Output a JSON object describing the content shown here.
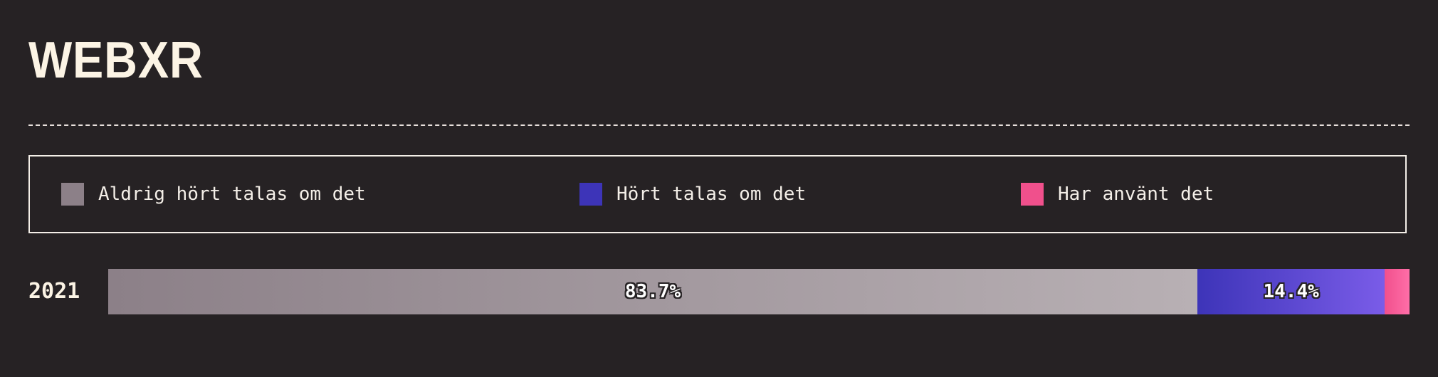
{
  "page": {
    "title": "WEBXR"
  },
  "legend": {
    "items": [
      {
        "label": "Aldrig hört talas om det",
        "color": "#8c8088"
      },
      {
        "label": "Hört talas om det",
        "color": "#3d34b8"
      },
      {
        "label": "Har använt det",
        "color": "#f0508c"
      }
    ]
  },
  "chart_data": {
    "type": "bar",
    "orientation": "horizontal",
    "stacked": true,
    "normalized": true,
    "title": "WEBXR",
    "categories": [
      "2021"
    ],
    "series": [
      {
        "name": "Aldrig hört talas om det",
        "values": [
          83.7
        ],
        "label": "83.7%",
        "color": "#8c8088"
      },
      {
        "name": "Hört talas om det",
        "values": [
          14.4
        ],
        "label": "14.4%",
        "color": "#3d34b8"
      },
      {
        "name": "Har använt det",
        "values": [
          1.9
        ],
        "label": "",
        "color": "#f0508c"
      }
    ],
    "legend_placement": "top",
    "grid": false
  }
}
